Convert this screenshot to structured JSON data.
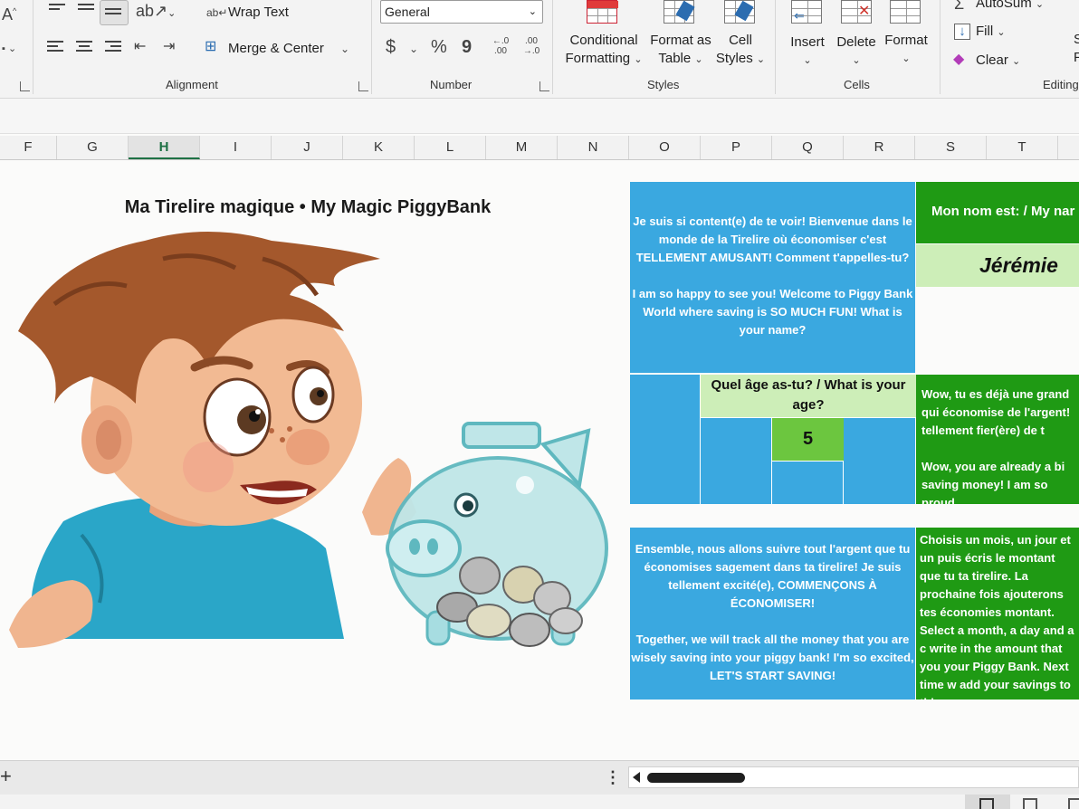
{
  "ribbon": {
    "font": {
      "grow_icon": "A"
    },
    "alignment": {
      "wrap_text": "Wrap Text",
      "merge_center": "Merge & Center",
      "group_label": "Alignment"
    },
    "number": {
      "format_value": "General",
      "currency_symbol": "$",
      "percent_symbol": "%",
      "comma_symbol": "9",
      "inc_decimal": "←.0 .00",
      "dec_decimal": ".00 →.0",
      "group_label": "Number"
    },
    "styles": {
      "conditional_formatting_1": "Conditional",
      "conditional_formatting_2": "Formatting",
      "format_as_table_1": "Format as",
      "format_as_table_2": "Table",
      "cell_styles_1": "Cell",
      "cell_styles_2": "Styles",
      "group_label": "Styles"
    },
    "cells": {
      "insert": "Insert",
      "delete": "Delete",
      "format": "Format",
      "group_label": "Cells"
    },
    "editing": {
      "autosum": "AutoSum",
      "fill": "Fill",
      "clear": "Clear",
      "group_label": "Editing",
      "cutoff_1": "S",
      "cutoff_2": "F"
    }
  },
  "columns": [
    "F",
    "G",
    "H",
    "I",
    "J",
    "K",
    "L",
    "M",
    "N",
    "O",
    "P",
    "Q",
    "R",
    "S",
    "T"
  ],
  "selected_column": "H",
  "sheet": {
    "title": "Ma Tirelire magique • My Magic PiggyBank",
    "welcome_fr": "Je suis si content(e) de te voir! Bienvenue dans le monde de la Tirelire où économiser c'est TELLEMENT AMUSANT! Comment t'appelles-tu?",
    "welcome_en": "I am so happy to see you! Welcome to Piggy Bank World where saving is SO MUCH FUN! What is your name?",
    "name_label": "Mon nom est: / My nar",
    "name_value": "Jérémie",
    "age_question": "Quel âge as-tu? / What is your age?",
    "age_value": "5",
    "proud_fr": "Wow, tu es déjà une grand qui économise de l'argent! tellement fier(ère) de t",
    "proud_en": "Wow, you are already a bi saving money! I am so proud",
    "together_fr": "Ensemble, nous allons suivre tout l'argent que tu économises sagement dans ta tirelire! Je suis tellement excité(e), COMMENÇONS À ÉCONOMISER!",
    "together_en": "Together, we will track all the money that you are wisely saving into your piggy bank! I'm so excited, LET'S START SAVING!",
    "choose_fr": "Choisis un mois, un jour et un puis écris le montant que tu ta tirelire. La prochaine fois ajouterons tes économies montant.",
    "choose_en": "Select a month, a day and a c write in the amount that you your Piggy Bank. Next time w add your savings to this am"
  },
  "tabbar": {
    "add_symbol": "+",
    "more_symbol": "⋮"
  },
  "colors": {
    "blue": "#3aa8e0",
    "green": "#1f9a14",
    "light_green": "#cdeeb8",
    "age_green": "#6cc63f",
    "accent": "#1e7145"
  }
}
